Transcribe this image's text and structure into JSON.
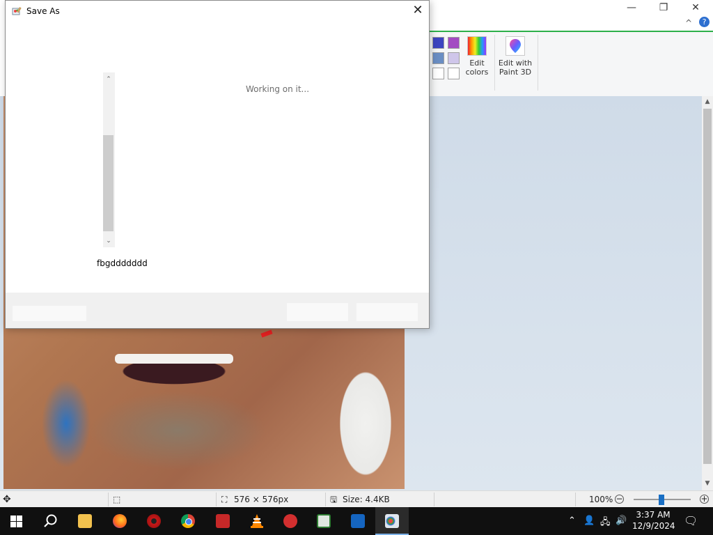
{
  "paint": {
    "ribbon": {
      "edit_colors_line1": "Edit",
      "edit_colors_line2": "colors",
      "paint3d_line1": "Edit with",
      "paint3d_line2": "Paint 3D"
    },
    "status": {
      "dimensions": "576 × 576px",
      "size": "Size: 4.4KB",
      "zoom": "100%"
    },
    "swatch_colors": [
      "#3c44c0",
      "#a34bc2",
      "#6a8ec3",
      "#cfc6ea",
      "#ffffff",
      "#ffffff"
    ]
  },
  "dialog": {
    "title": "Save As",
    "status_text": "Working on it...",
    "filename": "fbgddddddd"
  },
  "taskbar": {
    "time": "3:37 AM",
    "date": "12/9/2024"
  },
  "colors": {
    "accent_green": "#2db04a",
    "taskbar_bg": "#101010",
    "zoom_thumb": "#1a6fc4"
  }
}
